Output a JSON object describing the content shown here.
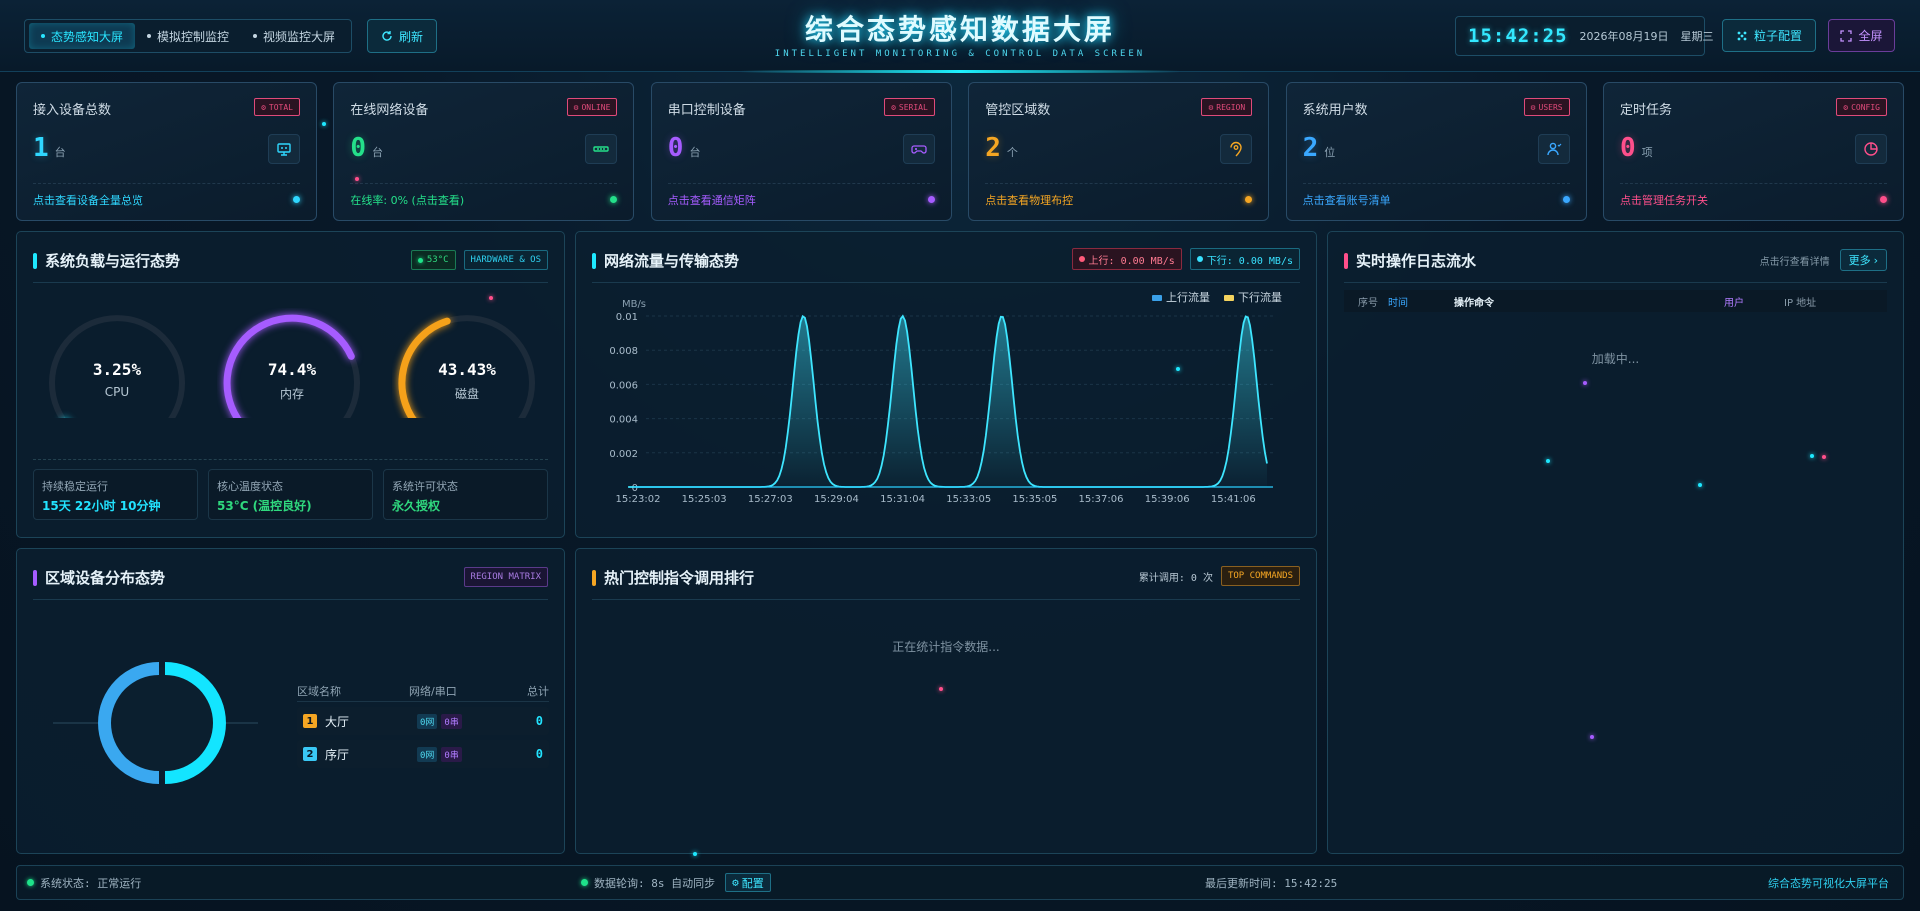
{
  "header": {
    "tabs": [
      {
        "label": "态势感知大屏",
        "active": true
      },
      {
        "label": "模拟控制监控",
        "active": false
      },
      {
        "label": "视频监控大屏",
        "active": false
      }
    ],
    "refresh_label": "刷新",
    "title": "综合态势感知数据大屏",
    "subtitle": "INTELLIGENT MONITORING & CONTROL DATA SCREEN",
    "clock": "15:42:25",
    "date": "2026年08月19日",
    "weekday": "星期三",
    "particle_label": "粒子配置",
    "fullscreen_label": "全屏"
  },
  "stats": [
    {
      "title": "接入设备总数",
      "tag": "TOTAL",
      "value": "1",
      "unit": "台",
      "link": "点击查看设备全量总览",
      "color": "#2fd7ff",
      "tagColor": "#e04a7a",
      "icon": "monitor-icon"
    },
    {
      "title": "在线网络设备",
      "tag": "ONLINE",
      "value": "0",
      "unit": "台",
      "link": "在线率: 0% (点击查看)",
      "color": "#24e08a",
      "tagColor": "#e04a7a",
      "icon": "network-icon"
    },
    {
      "title": "串口控制设备",
      "tag": "SERIAL",
      "value": "0",
      "unit": "台",
      "link": "点击查看通信矩阵",
      "color": "#a65cff",
      "tagColor": "#e04a7a",
      "icon": "gamepad-icon"
    },
    {
      "title": "管控区域数",
      "tag": "REGION",
      "value": "2",
      "unit": "个",
      "link": "点击查看物理布控",
      "color": "#f5a623",
      "tagColor": "#e04a7a",
      "icon": "location-icon"
    },
    {
      "title": "系统用户数",
      "tag": "USERS",
      "value": "2",
      "unit": "位",
      "link": "点击查看账号清单",
      "color": "#3aa8ff",
      "tagColor": "#e04a7a",
      "icon": "user-icon"
    },
    {
      "title": "定时任务",
      "tag": "CONFIG",
      "value": "0",
      "unit": "项",
      "link": "点击管理任务开关",
      "color": "#ff4f8b",
      "tagColor": "#e04a7a",
      "icon": "pie-icon"
    }
  ],
  "system": {
    "title": "系统负载与运行态势",
    "temp_tag": "53°C",
    "hw_tag": "HARDWARE & OS",
    "gauges": [
      {
        "label": "CPU",
        "value": "3.25%",
        "pct": 3.25,
        "color": "#1ee8ff"
      },
      {
        "label": "内存",
        "value": "74.4%",
        "pct": 74.4,
        "color": "#a65cff"
      },
      {
        "label": "磁盘",
        "value": "43.43%",
        "pct": 43.43,
        "color": "#f5a11a"
      }
    ],
    "info": [
      {
        "label": "持续稳定运行",
        "value": "15天 22小时 10分钟",
        "color": "#22e3ff"
      },
      {
        "label": "核心温度状态",
        "value": "53°C (温控良好)",
        "color": "#2fd87e"
      },
      {
        "label": "系统许可状态",
        "value": "永久授权",
        "color": "#2fd87e"
      }
    ]
  },
  "network": {
    "title": "网络流量与传输态势",
    "up_tag": "上行: 0.00 MB/s",
    "down_tag": "下行: 0.00 MB/s"
  },
  "chart_data": {
    "type": "area",
    "ylabel": "MB/s",
    "ylim": [
      0,
      0.01
    ],
    "yticks": [
      "0",
      "0.002",
      "0.004",
      "0.006",
      "0.008",
      "0.01"
    ],
    "x": [
      "15:23:02",
      "15:25:03",
      "15:27:03",
      "15:29:04",
      "15:31:04",
      "15:33:05",
      "15:35:05",
      "15:37:06",
      "15:39:06",
      "15:41:06"
    ],
    "series": [
      {
        "name": "上行流量",
        "color": "#3aa0e8",
        "values": [
          0,
          0,
          0,
          0,
          0,
          0,
          0,
          0,
          0,
          0
        ]
      },
      {
        "name": "下行流量",
        "color": "#f4d35e",
        "values": [
          0,
          0,
          0,
          0,
          0,
          0,
          0,
          0,
          0,
          0
        ]
      }
    ],
    "peaks": [
      2.5,
      4.0,
      5.5,
      9.2
    ],
    "grid": true,
    "legend": "top-right"
  },
  "logs": {
    "title": "实时操作日志流水",
    "hint": "点击行查看详情",
    "more_label": "更多",
    "columns": [
      "序号",
      "时间",
      "操作命令",
      "用户",
      "IP 地址"
    ],
    "loading": "加载中..."
  },
  "region": {
    "title": "区域设备分布态势",
    "tag": "REGION MATRIX",
    "headers": [
      "区域名称",
      "网络/串口",
      "总计"
    ],
    "rows": [
      {
        "rank": "1",
        "name": "大厅",
        "net": "0网",
        "serial": "0串",
        "total": "0",
        "rankColor": "#f5a623"
      },
      {
        "rank": "2",
        "name": "序厅",
        "net": "0网",
        "serial": "0串",
        "total": "0",
        "rankColor": "#3ac8f5"
      }
    ]
  },
  "commands": {
    "title": "热门控制指令调用排行",
    "count_label": "累计调用: 0 次",
    "tag": "TOP COMMANDS",
    "empty": "正在统计指令数据..."
  },
  "footer": {
    "status": "系统状态: 正常运行",
    "polling": "数据轮询: 8s 自动同步",
    "config_label": "配置",
    "updated": "最后更新时间: 15:42:25",
    "brand": "综合态势可视化大屏平台"
  }
}
